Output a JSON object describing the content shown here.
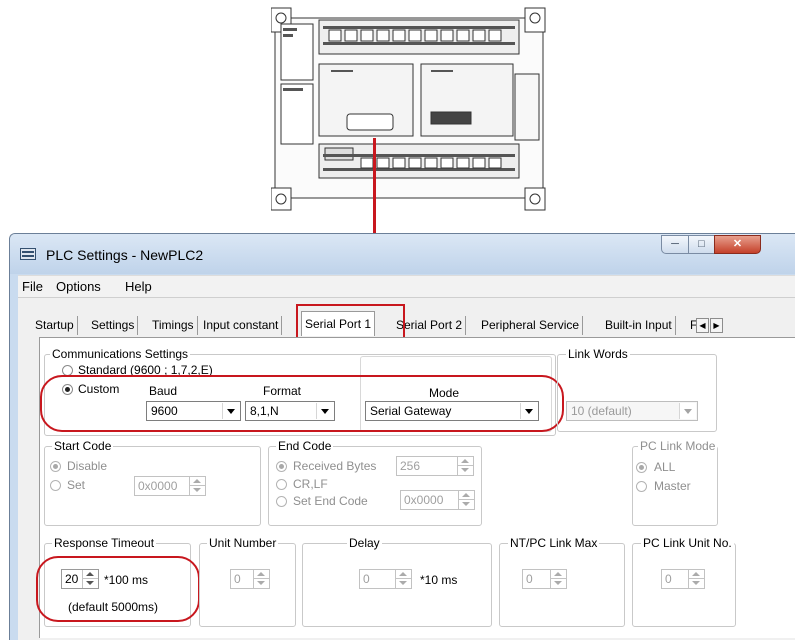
{
  "window": {
    "title": "PLC Settings - NewPLC2"
  },
  "menu": [
    "File",
    "Options",
    "Help"
  ],
  "tabs": [
    "Startup",
    "Settings",
    "Timings",
    "Input constant",
    "Serial Port 1",
    "Serial Port 2",
    "Peripheral Service",
    "Built-in Input",
    "F"
  ],
  "selected_tab": "Serial Port 1",
  "comms": {
    "label": "Communications Settings",
    "standard_label": "Standard (9600 ; 1,7,2,E)",
    "custom_label": "Custom",
    "selected": "Custom",
    "baud_label": "Baud",
    "baud_value": "9600",
    "format_label": "Format",
    "format_value": "8,1,N",
    "mode_label": "Mode",
    "mode_value": "Serial Gateway"
  },
  "link_words": {
    "label": "Link Words",
    "value": "10 (default)"
  },
  "start_code": {
    "label": "Start Code",
    "disable_label": "Disable",
    "set_label": "Set",
    "selected": "Disable",
    "value": "0x0000"
  },
  "end_code": {
    "label": "End Code",
    "received_label": "Received Bytes",
    "received_value": "256",
    "crlf_label": "CR,LF",
    "set_end_label": "Set End Code",
    "selected": "Received Bytes",
    "set_end_value": "0x0000"
  },
  "pc_link_mode": {
    "label": "PC Link Mode",
    "all_label": "ALL",
    "master_label": "Master",
    "selected": "ALL"
  },
  "response_timeout": {
    "label": "Response Timeout",
    "value": "20",
    "unit": "*100 ms",
    "default_text": "(default 5000ms)"
  },
  "unit_number": {
    "label": "Unit Number",
    "value": "0"
  },
  "delay": {
    "label": "Delay",
    "value": "0",
    "unit": "*10 ms"
  },
  "nt_pc_link_max": {
    "label": "NT/PC Link Max",
    "value": "0"
  },
  "pc_link_unit_no": {
    "label": "PC Link Unit No.",
    "value": "0"
  },
  "colors": {
    "annotation": "#c8171e",
    "window_frame": "#c9dbef",
    "panel": "#ffffff"
  }
}
